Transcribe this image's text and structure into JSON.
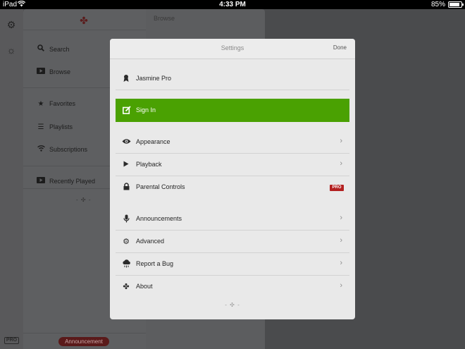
{
  "status_bar": {
    "carrier": "iPad",
    "time": "4:33 PM",
    "battery": "85%"
  },
  "rail": {
    "pro_badge": "PRO"
  },
  "sidebar": {
    "items": [
      {
        "label": "Search",
        "icon": "search-icon"
      },
      {
        "label": "Browse",
        "icon": "browse-icon"
      },
      {
        "label": "Favorites",
        "icon": "star-icon"
      },
      {
        "label": "Playlists",
        "icon": "list-icon"
      },
      {
        "label": "Subscriptions",
        "icon": "wifi-icon"
      },
      {
        "label": "Recently Played",
        "icon": "play-box-icon"
      }
    ],
    "dots": "- ✣ -",
    "announcement_button": "Announcement"
  },
  "browse": {
    "title": "Browse"
  },
  "settings": {
    "title": "Settings",
    "done": "Done",
    "product": "Jasmine Pro",
    "sign_in": "Sign In",
    "group1": [
      {
        "label": "Appearance",
        "icon": "eye-icon",
        "accessory": "chevron"
      },
      {
        "label": "Playback",
        "icon": "play-icon",
        "accessory": "chevron"
      },
      {
        "label": "Parental Controls",
        "icon": "lock-icon",
        "accessory": "pro",
        "badge": "PRO"
      }
    ],
    "group2": [
      {
        "label": "Announcements",
        "icon": "microphone-icon",
        "accessory": "chevron"
      },
      {
        "label": "Advanced",
        "icon": "gears-icon",
        "accessory": "chevron"
      },
      {
        "label": "Report a Bug",
        "icon": "bug-cloud-icon",
        "accessory": "chevron"
      },
      {
        "label": "About",
        "icon": "about-icon",
        "accessory": "chevron"
      }
    ],
    "dots": "- ✣ -"
  },
  "colors": {
    "sign_in_green": "#4aa102",
    "pro_red": "#b32020",
    "announcement_red": "#5a1a1a"
  }
}
